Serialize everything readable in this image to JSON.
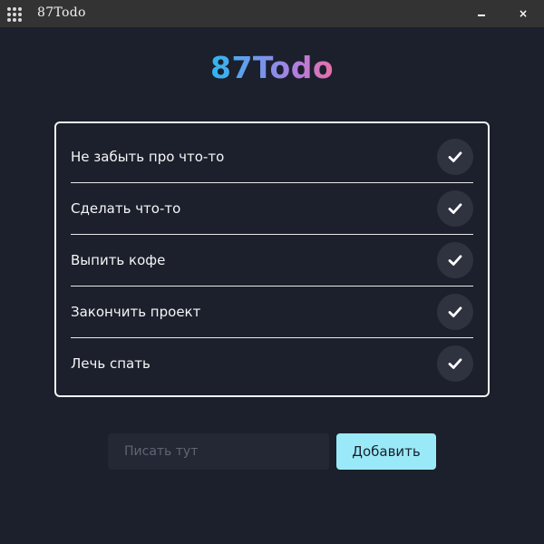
{
  "window": {
    "title": "87Todo",
    "app_icon": "app-grid-icon",
    "minimize_icon": "minimize-icon",
    "close_icon": "close-icon",
    "close_glyph": "×"
  },
  "logo": {
    "text": "87Todo",
    "gradient_colors": [
      "#2fb5f0",
      "#7e92ea",
      "#b07ee0",
      "#ea6fa5"
    ]
  },
  "todos": [
    {
      "label": "Не забыть про что-то",
      "action_icon": "check-icon"
    },
    {
      "label": "Сделать что-то",
      "action_icon": "check-icon"
    },
    {
      "label": "Выпить кофе",
      "action_icon": "check-icon"
    },
    {
      "label": "Закончить проект",
      "action_icon": "check-icon"
    },
    {
      "label": "Лечь спать",
      "action_icon": "check-icon"
    }
  ],
  "input": {
    "value": "",
    "placeholder": "Писать тут"
  },
  "add_button": {
    "label": "Добавить"
  },
  "colors": {
    "background": "#1b202c",
    "titlebar": "#333333",
    "card_border": "#f2f2f2",
    "check_button_bg": "#2f3340",
    "input_bg": "#232834",
    "accent_button": "#9ae9f9"
  }
}
